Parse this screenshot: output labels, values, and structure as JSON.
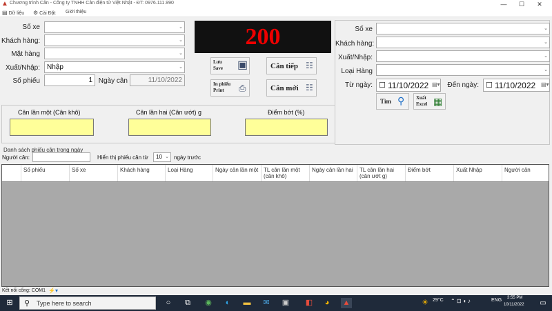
{
  "window": {
    "title": "Chương trình Cân - Công ty TNHH Cân điện tử Việt Nhật - ĐT: 0976.111.990",
    "min": "—",
    "max": "☐",
    "close": "✕"
  },
  "menu": [
    {
      "icon": "▤",
      "label": "Dữ liệu"
    },
    {
      "icon": "⚙",
      "label": "Cài Đặt"
    },
    {
      "icon": "",
      "label": "Giới thiệu"
    }
  ],
  "form": {
    "so_xe_label": "Số xe",
    "khach_hang_label": "Khách hàng:",
    "mat_hang_label": "Mặt hàng",
    "xuat_nhap_label": "Xuất/Nhập:",
    "xuat_nhap_value": "Nhập",
    "so_phieu_label": "Số phiếu",
    "so_phieu_value": "1",
    "ngay_can_label": "Ngày cân",
    "ngay_can_value": "11/10/2022"
  },
  "display": {
    "weight": "200"
  },
  "buttons": {
    "luu": "Lưu\nSave",
    "can_tiep": "Cân tiếp",
    "in_phieu": "In phiếu\nPrint",
    "can_moi": "Cân mới"
  },
  "weights": {
    "lan_mot": "Cân lần một (Cân khô)",
    "lan_hai": "Cân lần hai (Cân ướt) g",
    "diem_bot": "Điểm bớt (%)"
  },
  "filter": {
    "so_xe_label": "Số xe",
    "khach_hang_label": "Khách hàng:",
    "xuat_nhap_label": "Xuất/Nhập:",
    "loai_hang_label": "Loại Hàng",
    "tu_ngay_label": "Từ ngày:",
    "tu_ngay_value": "11/10/2022",
    "den_ngay_label": "Đến ngày:",
    "den_ngay_value": "11/10/2022",
    "tim_label": "Tìm",
    "xuat_excel_label": "Xuất\nExcel"
  },
  "list": {
    "title": "Danh sách phiếu cân trong ngày",
    "nguoi_can_label": "Người cân:",
    "hien_thi_label": "Hiển thị phiếu cân từ",
    "days_value": "10",
    "ngay_truoc_label": "ngày trước"
  },
  "table": {
    "columns": [
      "Số phiếu",
      "Số xe",
      "Khách hàng",
      "Loại Hàng",
      "Ngày cân lần một",
      "TL cân lần một (cân khô)",
      "Ngày cân lần hai",
      "TL cân lần hai (cân ướt g)",
      "Điểm bớt",
      "Xuất Nhập",
      "Người cân"
    ]
  },
  "status": {
    "connection": "Kết nối cổng: COM1"
  },
  "taskbar": {
    "search_placeholder": "Type here to search",
    "weather": "29°C",
    "lang": "ENG",
    "time": "3:55 PM",
    "date": "10/11/2022"
  }
}
